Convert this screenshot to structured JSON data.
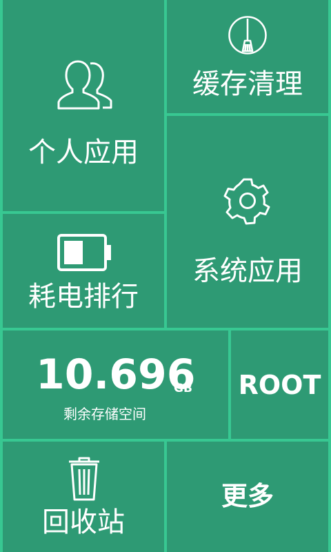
{
  "tiles": {
    "personal_apps": {
      "label": "个人应用",
      "icon": "users-icon"
    },
    "cache_clean": {
      "label": "缓存清理",
      "icon": "broom-icon"
    },
    "system_apps": {
      "label": "系统应用",
      "icon": "gear-icon"
    },
    "power_rank": {
      "label": "耗电排行",
      "icon": "battery-icon"
    },
    "storage": {
      "value": "10.696",
      "unit": "GB",
      "caption": "剩余存储空间"
    },
    "root": {
      "label": "ROOT"
    },
    "recycle_bin": {
      "label": "回收站",
      "icon": "trash-icon"
    },
    "more": {
      "label": "更多"
    }
  },
  "colors": {
    "background": "#38c892",
    "tile": "#2e9a74",
    "text": "#ffffff"
  }
}
